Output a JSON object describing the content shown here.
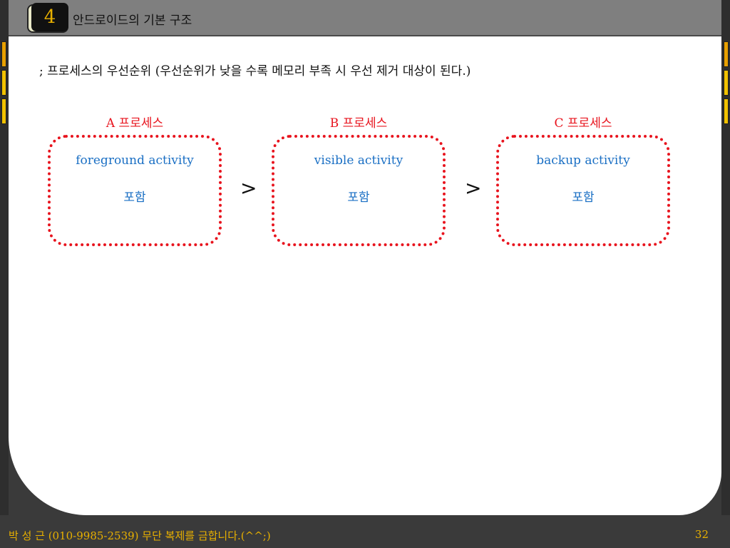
{
  "header": {
    "slide_number": "4",
    "title": "안드로이드의 기본 구조"
  },
  "intro": "; 프로세스의 우선순위 (우선순위가 낮을 수록 메모리 부족 시 우선 제거 대상이 된다.)",
  "processes": [
    {
      "label": "A 프로세스",
      "activity": "foreground activity",
      "include": "포함"
    },
    {
      "label": "B 프로세스",
      "activity": "visible activity",
      "include": "포함"
    },
    {
      "label": "C 프로세스",
      "activity": "backup activity",
      "include": "포함"
    }
  ],
  "comparators": [
    ">",
    ">"
  ],
  "footer": {
    "author_notice": "박 성 근 (010-9985-2539)  무단 복제를 금합니다.(^^;)",
    "page": "32"
  },
  "colors": {
    "process_label": "#e8141e",
    "activity_text": "#1a6fc4",
    "footer_text": "#e8b000",
    "slide_number": "#e8b000"
  }
}
